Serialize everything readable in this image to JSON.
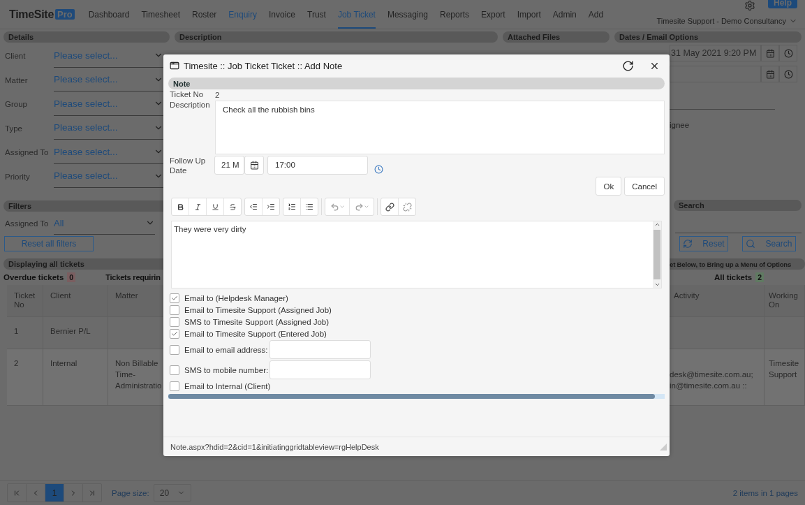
{
  "nav": {
    "logo": "TimeSite",
    "logo_badge": "Pro",
    "items": [
      {
        "label": "Dashboard",
        "selected": false,
        "highlighted": false
      },
      {
        "label": "Timesheet",
        "selected": false,
        "highlighted": false
      },
      {
        "label": "Roster",
        "selected": false,
        "highlighted": false
      },
      {
        "label": "Enquiry",
        "selected": false,
        "highlighted": true
      },
      {
        "label": "Invoice",
        "selected": false,
        "highlighted": false
      },
      {
        "label": "Trust",
        "selected": false,
        "highlighted": false
      },
      {
        "label": "Job Ticket",
        "selected": true,
        "highlighted": false
      },
      {
        "label": "Messaging",
        "selected": false,
        "highlighted": false
      },
      {
        "label": "Reports",
        "selected": false,
        "highlighted": false
      },
      {
        "label": "Export",
        "selected": false,
        "highlighted": false
      },
      {
        "label": "Import",
        "selected": false,
        "highlighted": false
      },
      {
        "label": "Admin",
        "selected": false,
        "highlighted": false
      },
      {
        "label": "Add",
        "selected": false,
        "highlighted": false
      }
    ],
    "help": "Help",
    "user": "Timesite Support - Demo Consultancy"
  },
  "section_headers": [
    "Details",
    "Description",
    "Attached Files",
    "Dates / Email Options"
  ],
  "details": [
    {
      "label": "Client",
      "value": "Please select..."
    },
    {
      "label": "Matter",
      "value": "Please select..."
    },
    {
      "label": "Group",
      "value": "Please select..."
    },
    {
      "label": "Type",
      "value": "Please select..."
    },
    {
      "label": "Assigned To",
      "value": "Please select..."
    },
    {
      "label": "Priority",
      "value": "Please select..."
    }
  ],
  "dates": {
    "required_by_value": "31 May 2021  9:20 PM",
    "assignee_label": "ignee"
  },
  "filters": {
    "title": "Filters",
    "assigned_label": "Assigned To",
    "assigned_value": "All",
    "reset": "Reset all filters"
  },
  "search": {
    "title": "Search",
    "reset": "Reset",
    "search": "Search"
  },
  "tickets": {
    "title": "Displaying all tickets",
    "banner": "et Below, to Bring up a Menu of Options",
    "counters": [
      {
        "label": "Overdue tickets",
        "count": "0",
        "color": "#7a5e60"
      },
      {
        "label": "All tickets",
        "count": "2",
        "color": "#607a62"
      }
    ],
    "requiring": "Tickets requirin",
    "columns_left": [
      "Ticket No",
      "Client",
      "Matter"
    ],
    "columns_right": [
      "Activity",
      "Working On"
    ],
    "rows": [
      {
        "ticket_no": "1",
        "client": "Bernier P/L"
      },
      {
        "ticket_no": "2",
        "client": "Internal",
        "matter": "Non Billable Time-Administratio",
        "activity": [
          "desk@timesite.com.au;",
          "in@timesite.com.au ::"
        ],
        "working_on": "Timesite Support"
      }
    ]
  },
  "modal": {
    "title": "Timesite :: Job Ticket Ticket :: Add Note",
    "section": "Note",
    "ticket_no_label": "Ticket No",
    "ticket_no": "2",
    "description_label": "Description",
    "description": "Check all the rubbish bins",
    "follow_up_label": "Follow Up Date",
    "follow_up_date": "21 M",
    "follow_up_time": "17:00",
    "ok": "Ok",
    "cancel": "Cancel",
    "note_text": "They were very dirty",
    "options": [
      {
        "kind": "check",
        "label": "Email to (Helpdesk Manager)",
        "checked": true
      },
      {
        "kind": "check",
        "label": "Email to Timesite Support (Assigned Job)",
        "checked": false
      },
      {
        "kind": "check",
        "label": "SMS to Timesite Support (Assigned Job)",
        "checked": false
      },
      {
        "kind": "check",
        "label": "Email to Timesite Support (Entered Job)",
        "checked": true
      },
      {
        "kind": "check_input",
        "label": "Email to email address:",
        "checked": false
      },
      {
        "kind": "check_input",
        "label": "SMS to mobile number:",
        "checked": false
      },
      {
        "kind": "check",
        "label": "Email to Internal (Client)",
        "checked": false
      }
    ],
    "url": "Note.aspx?hdid=2&cid=1&initiatinggridtableview=rgHelpDesk"
  },
  "pager": {
    "pages": [
      {
        "label": "1",
        "selected": true
      }
    ],
    "page_size_label": "Page size:",
    "page_size": "20",
    "summary": "2 items in 1 pages"
  }
}
